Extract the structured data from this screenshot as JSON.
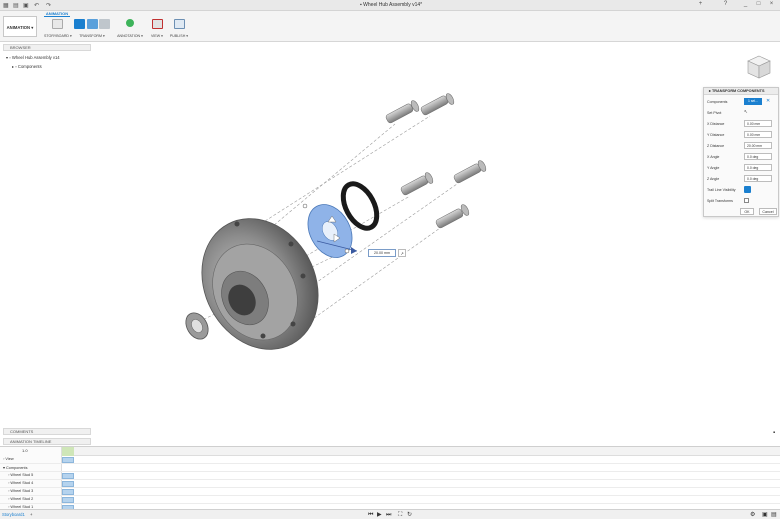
{
  "window": {
    "title": "Wheel Hub Assembly v14*",
    "controls": [
      "+",
      "?",
      "_",
      "□",
      "×"
    ]
  },
  "ribbon": {
    "workspace": "ANIMATION",
    "tab": "ANIMATION",
    "tools": [
      {
        "label": "STORYBOARD ▾",
        "icon": "storyboard-icon"
      },
      {
        "label": "TRANSFORM ▾",
        "icon": "transform-icon"
      },
      {
        "label": "ANNOTATION ▾",
        "icon": "annotation-icon"
      },
      {
        "label": "VIEW ▾",
        "icon": "view-icon"
      },
      {
        "label": "PUBLISH ▾",
        "icon": "publish-icon"
      }
    ]
  },
  "browser": {
    "header": "BROWSER",
    "root": "Wheel Hub Assembly v14",
    "child": "Components"
  },
  "transform_panel": {
    "title": "TRANSFORM COMPONENTS",
    "components_label": "Components",
    "components_value": "1 sel...",
    "set_pivot_label": "Set Pivot",
    "x_distance_label": "X Distance",
    "x_distance": "0.00 mm",
    "y_distance_label": "Y Distance",
    "y_distance": "0.00 mm",
    "z_distance_label": "Z Distance",
    "z_distance": "20.00 mm",
    "x_angle_label": "X Angle",
    "x_angle": "0.0 deg",
    "y_angle_label": "Y Angle",
    "y_angle": "0.0 deg",
    "z_angle_label": "Z Angle",
    "z_angle": "0.0 deg",
    "trail_line_label": "Trail Line Visibility",
    "split_label": "Split Transforms",
    "ok": "OK",
    "cancel": "Cancel"
  },
  "viewport": {
    "distance_input": "20.00 mm"
  },
  "comments": {
    "header": "COMMENTS"
  },
  "timeline": {
    "header": "ANIMATION TIMELINE",
    "duration": "1.0",
    "rows": [
      "View",
      "Components",
      "Wheel Stud 5",
      "Wheel Stud 4",
      "Wheel Stud 3",
      "Wheel Stud 2",
      "Wheel Stud 1"
    ]
  },
  "bottom": {
    "storyboard_tab": "Storyboard1",
    "add_tab": "+"
  },
  "colors": {
    "accent": "#1a7fcf",
    "selected_part": "#8fb3e8",
    "part_metal": "#8a8a8a"
  }
}
